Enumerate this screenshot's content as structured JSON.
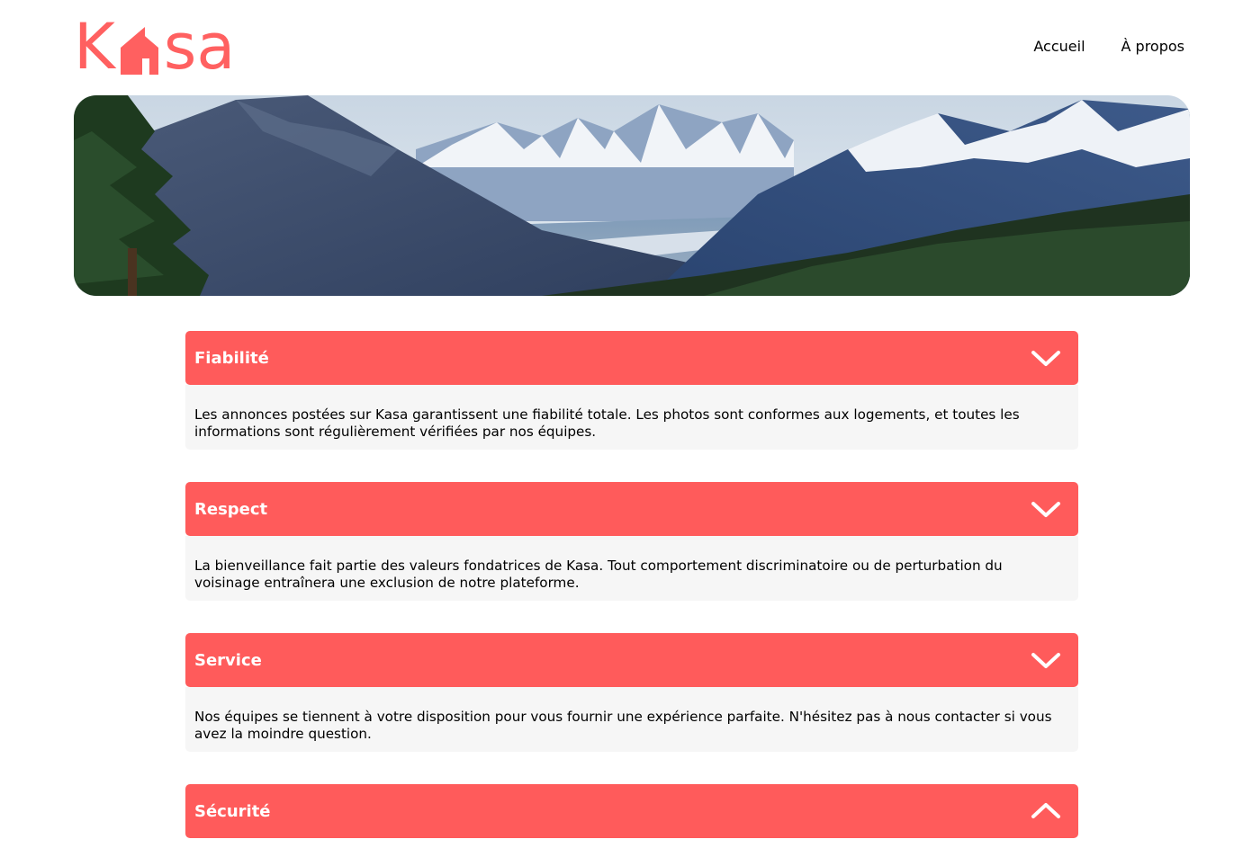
{
  "brand": {
    "name": "Kasa",
    "color": "#FF6060",
    "logo_letters": [
      "K",
      "s",
      "a"
    ]
  },
  "nav": {
    "items": [
      {
        "label": "Accueil"
      },
      {
        "label": "À propos"
      }
    ]
  },
  "banner": {
    "icon": "mountain-landscape-image"
  },
  "accordions": [
    {
      "title": "Fiabilité",
      "expanded": true,
      "icon": "chevron-down-icon",
      "text": "Les annonces postées sur Kasa garantissent une fiabilité totale. Les photos sont conformes aux logements, et toutes les informations sont régulièrement vérifiées par nos équipes."
    },
    {
      "title": "Respect",
      "expanded": true,
      "icon": "chevron-down-icon",
      "text": "La bienveillance fait partie des valeurs fondatrices de Kasa. Tout comportement discriminatoire ou de perturbation du voisinage entraînera une exclusion de notre plateforme."
    },
    {
      "title": "Service",
      "expanded": true,
      "icon": "chevron-down-icon",
      "text": "Nos équipes se tiennent à votre disposition pour vous fournir une expérience parfaite. N'hésitez pas à nous contacter si vous avez la moindre question."
    },
    {
      "title": "Sécurité",
      "expanded": false,
      "icon": "chevron-up-icon",
      "text": ""
    }
  ],
  "colors": {
    "accent": "#FF6060",
    "accordion_header": "#FF5B5B",
    "accordion_body": "#F6F6F6"
  }
}
